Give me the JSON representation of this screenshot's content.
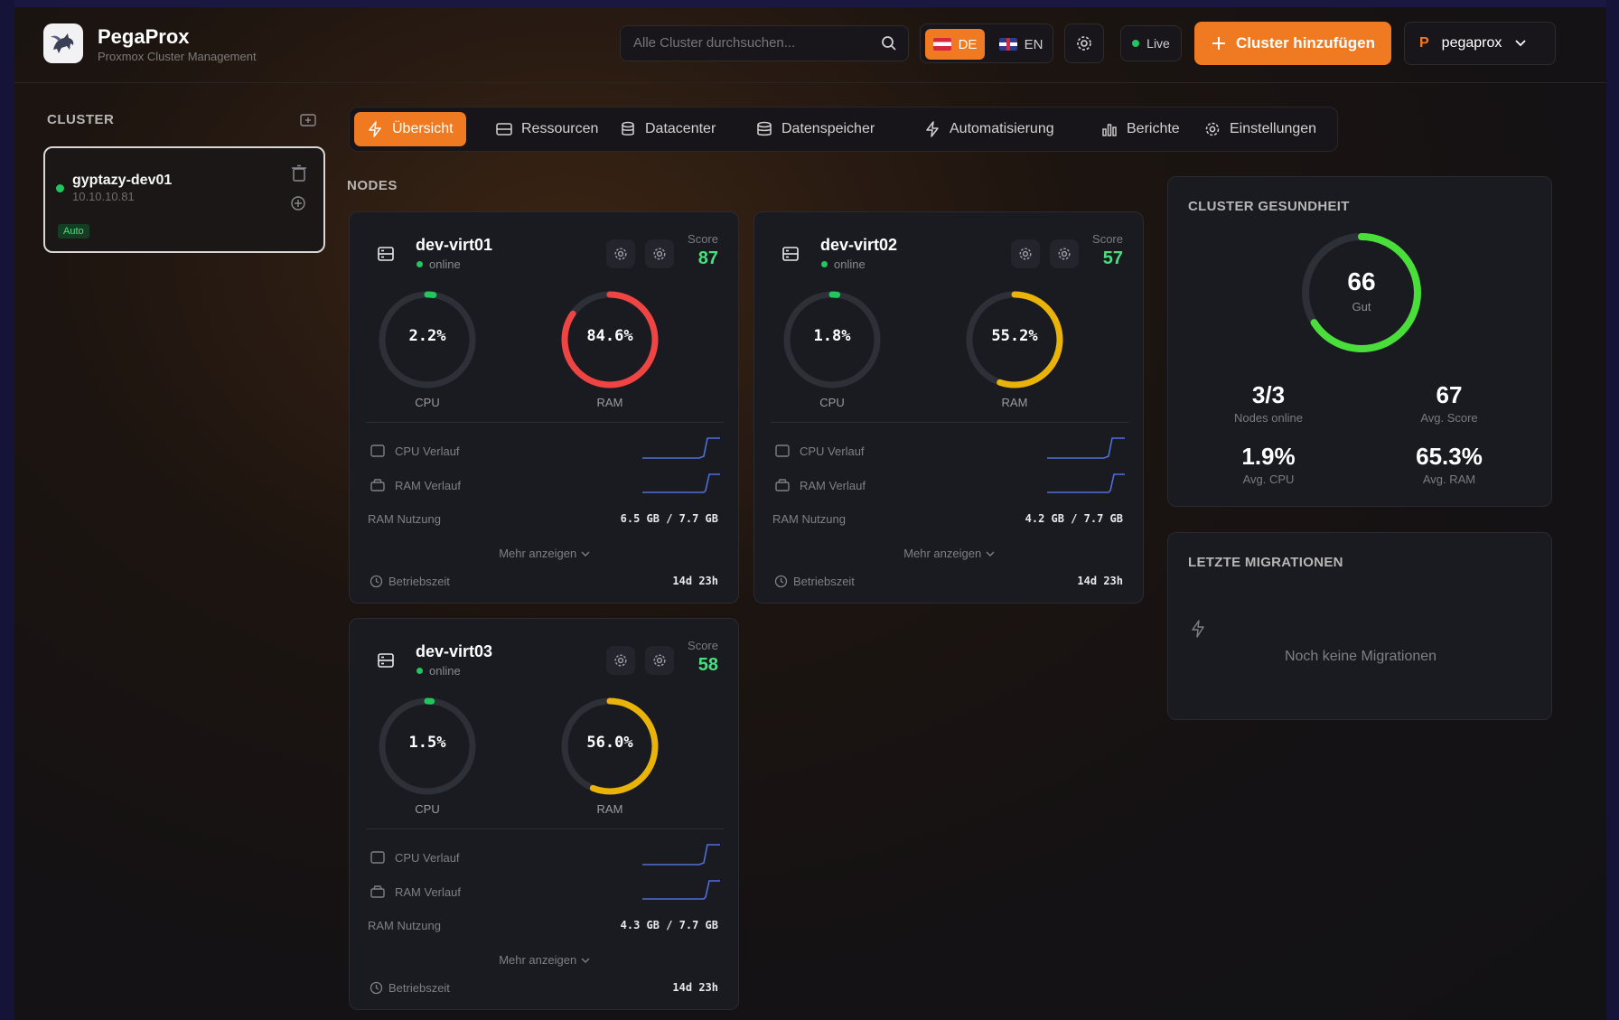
{
  "header": {
    "app_name": "PegaProx",
    "app_subtitle": "Proxmox Cluster Management",
    "search_placeholder": "Alle Cluster durchsuchen...",
    "lang_de": "DE",
    "lang_en": "EN",
    "live_label": "Live",
    "add_cluster_label": "Cluster hinzufügen",
    "user_initial": "P",
    "user_name": "pegaprox"
  },
  "sidebar": {
    "title": "CLUSTER",
    "clusters": [
      {
        "name": "gyptazy-dev01",
        "ip": "10.10.10.81",
        "tag": "Auto",
        "status": "online"
      }
    ]
  },
  "tabs": [
    {
      "label": "Übersicht",
      "icon": "bolt-icon",
      "active": true
    },
    {
      "label": "Ressourcen",
      "icon": "server-icon"
    },
    {
      "label": "Datacenter",
      "icon": "database-icon"
    },
    {
      "label": "Datenspeicher",
      "icon": "storage-icon"
    },
    {
      "label": "Automatisierung",
      "icon": "bolt-icon"
    },
    {
      "label": "Berichte",
      "icon": "chart-icon"
    },
    {
      "label": "Einstellungen",
      "icon": "gear-icon"
    }
  ],
  "nodes_title": "NODES",
  "labels": {
    "score": "Score",
    "cpu": "CPU",
    "ram": "RAM",
    "cpu_history": "CPU Verlauf",
    "ram_history": "RAM Verlauf",
    "ram_usage": "RAM Nutzung",
    "show_more": "Mehr anzeigen",
    "uptime": "Betriebszeit"
  },
  "nodes": [
    {
      "name": "dev-virt01",
      "status": "online",
      "score": "87",
      "cpu": "2.2%",
      "cpu_value": 2.2,
      "ram": "84.6%",
      "ram_value": 84.6,
      "ram_color": "#ef4444",
      "ram_usage": "6.5 GB / 7.7 GB",
      "uptime": "14d 23h"
    },
    {
      "name": "dev-virt02",
      "status": "online",
      "score": "57",
      "cpu": "1.8%",
      "cpu_value": 1.8,
      "ram": "55.2%",
      "ram_value": 55.2,
      "ram_color": "#eab308",
      "ram_usage": "4.2 GB / 7.7 GB",
      "uptime": "14d 23h"
    },
    {
      "name": "dev-virt03",
      "status": "online",
      "score": "58",
      "cpu": "1.5%",
      "cpu_value": 1.5,
      "ram": "56.0%",
      "ram_value": 56.0,
      "ram_color": "#eab308",
      "ram_usage": "4.3 GB / 7.7 GB",
      "uptime": "14d 23h"
    }
  ],
  "health": {
    "title": "CLUSTER GESUNDHEIT",
    "score": "66",
    "score_value": 66,
    "score_label": "Gut",
    "nodes_online": "3/3",
    "nodes_online_label": "Nodes online",
    "avg_score": "67",
    "avg_score_label": "Avg. Score",
    "avg_cpu": "1.9%",
    "avg_cpu_label": "Avg. CPU",
    "avg_ram": "65.3%",
    "avg_ram_label": "Avg. RAM"
  },
  "migrations": {
    "title": "LETZTE MIGRATIONEN",
    "empty": "Noch keine Migrationen"
  },
  "colors": {
    "accent": "#f07a22",
    "ok": "#22c55e",
    "warn": "#eab308",
    "danger": "#ef4444"
  }
}
